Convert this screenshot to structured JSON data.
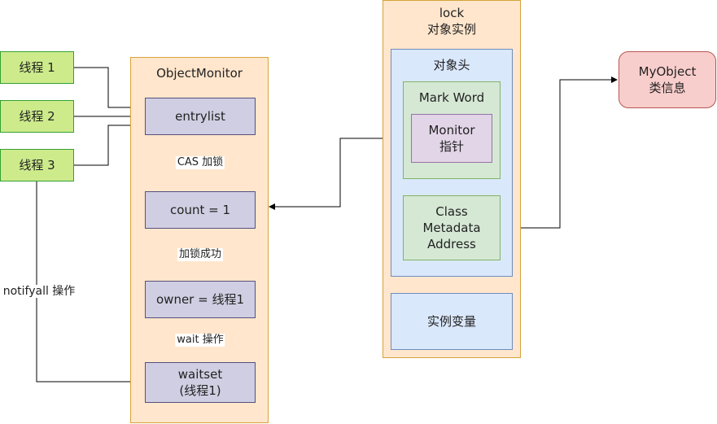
{
  "threads": [
    "线程 1",
    "线程 2",
    "线程 3"
  ],
  "monitor": {
    "title": "ObjectMonitor",
    "entrylist": "entrylist",
    "count": "count = 1",
    "owner": "owner = 线程1",
    "waitset": "waitset\n(线程1)"
  },
  "edge_labels": {
    "cas": "CAS 加锁",
    "success": "加锁成功",
    "wait": "wait 操作",
    "notify": "notifyall 操作"
  },
  "lock": {
    "title": "lock\n对象实例",
    "header": "对象头",
    "mark_word": "Mark Word",
    "monitor_ptr": "Monitor\n指针",
    "class_meta": "Class\nMetadata\nAddress",
    "instance_vars": "实例变量"
  },
  "class_info": "MyObject\n类信息",
  "colors": {
    "thread_fill": "#cdeb8b",
    "container_fill": "#ffe6cc",
    "header_fill": "#dae8fc",
    "markword_fill": "#d5e8d4",
    "monitor_node_fill": "#d0cee2",
    "pointer_fill": "#e1d5e7",
    "class_fill": "#f8cecc"
  }
}
